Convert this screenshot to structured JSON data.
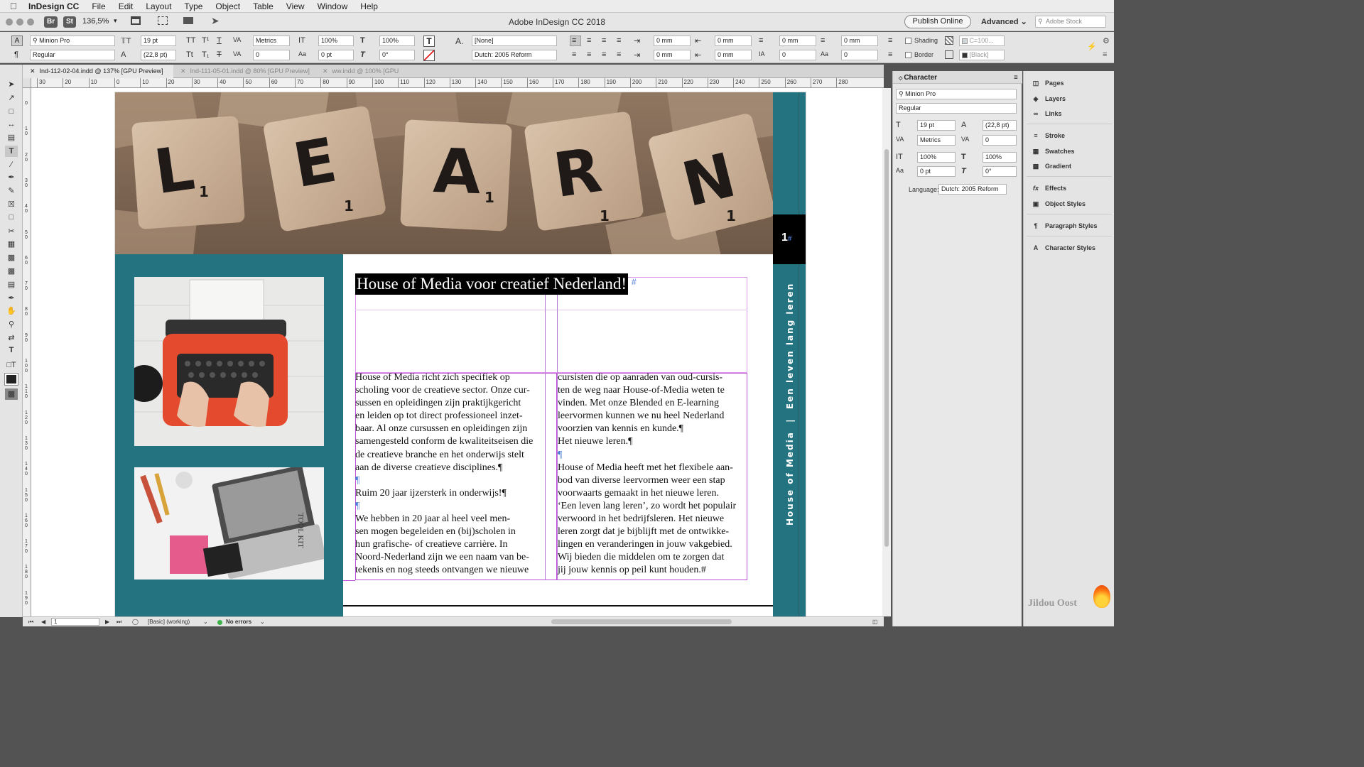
{
  "menubar": {
    "app": "InDesign CC",
    "items": [
      "File",
      "Edit",
      "Layout",
      "Type",
      "Object",
      "Table",
      "View",
      "Window",
      "Help"
    ]
  },
  "titlebar": {
    "title": "Adobe InDesign CC 2018",
    "bridge": "Br",
    "stock": "St",
    "zoom": "136,5%",
    "publish": "Publish Online",
    "workspace": "Advanced",
    "stock_search": "Adobe Stock"
  },
  "control": {
    "font": "Minion Pro",
    "style": "Regular",
    "size": "19 pt",
    "leading": "(22,8 pt)",
    "kerning": "Metrics",
    "tracking": "0",
    "vscale": "100%",
    "hscale": "100%",
    "baseline": "0 pt",
    "skew": "0°",
    "char_style": "[None]",
    "language": "Dutch: 2005 Reform",
    "indent_left": "0 mm",
    "indent_right": "0 mm",
    "first_indent": "0 mm",
    "last_indent": "0 mm",
    "space_before": "0 mm",
    "space_after": "0 mm",
    "drop_lines": "0",
    "drop_chars": "0",
    "shading": "Shading",
    "border": "Border",
    "shade_color": "C=100...",
    "border_color": "[Black]"
  },
  "tabs": [
    {
      "label": "Ind-112-02-04.indd @ 137% [GPU Preview]",
      "active": true
    },
    {
      "label": "Ind-111-05-01.indd @ 80% [GPU Preview]",
      "active": false
    },
    {
      "label": "ww.indd @ 100% [GPU Preview]",
      "active": false
    }
  ],
  "ruler": {
    "h": [
      "30",
      "20",
      "10",
      "0",
      "10",
      "20",
      "30",
      "40",
      "50",
      "60",
      "70",
      "80",
      "90",
      "100",
      "110",
      "120",
      "130",
      "140",
      "150",
      "160",
      "170",
      "180",
      "190",
      "200",
      "210",
      "220",
      "230",
      "240",
      "250",
      "260",
      "270",
      "280"
    ],
    "v": [
      "0",
      "1 0",
      "2 0",
      "3 0",
      "4 0",
      "5 0",
      "6 0",
      "7 0",
      "8 0",
      "9 0",
      "1 0 0",
      "1 1 0",
      "1 2 0",
      "1 3 0",
      "1 4 0",
      "1 5 0",
      "1 6 0",
      "1 7 0",
      "1 8 0",
      "1 9 0",
      "2 0 0"
    ]
  },
  "document": {
    "hero_tiles": [
      "L",
      "E",
      "A",
      "R",
      "N"
    ],
    "tile_score": "1",
    "page_number": "1",
    "page_number_mark": "#",
    "sidebar_text": "House of Media  |  Een leven lang leren",
    "tool_kit_label": "TOOL KIT",
    "heading": "House of Media voor creatief Nederland!",
    "heading_mark": "#",
    "col1": [
      "House of Media richt zich specifiek op",
      "scholing voor de creatieve sector. Onze cur-",
      "sussen en opleidingen zijn praktijkgericht",
      "en leiden op tot direct professioneel inzet-",
      "baar. Al onze cursussen en opleidingen zijn",
      "samengesteld conform de kwaliteitseisen die",
      "de creatieve branche en het onderwijs stelt",
      "aan de diverse creatieve disciplines.¶",
      "¶",
      "Ruim 20 jaar ijzersterk in onderwijs!¶",
      "¶",
      "We hebben in 20 jaar al heel veel men-",
      "sen mogen begeleiden en (bij)scholen in",
      "hun grafische- of creatieve carrière. In",
      "Noord-Nederland zijn we een naam van be-",
      "tekenis en nog steeds ontvangen we nieuwe"
    ],
    "col2": [
      "cursisten die op aanraden van oud-cursis-",
      "ten de weg naar House-of-Media weten te",
      "vinden. Met onze Blended en E-learning",
      "leervormen kunnen we nu heel Nederland",
      "voorzien van kennis en kunde.¶",
      "Het nieuwe leren.¶",
      "¶",
      "House of Media heeft met het flexibele aan-",
      "bod van diverse leervormen weer een stap",
      "voorwaarts gemaakt in het nieuwe leren.",
      "‘Een leven lang leren’, zo wordt het populair",
      "verwoord in het bedrijfsleren. Het nieuwe",
      "leren zorgt dat je bijblijft met de ontwikke-",
      "lingen en veranderingen in jouw vakgebied.",
      "Wij bieden die middelen om te zorgen dat",
      "jij jouw kennis op peil kunt houden.#"
    ]
  },
  "statusbar": {
    "page": "1",
    "preflight_profile": "[Basic] (working)",
    "errors": "No errors"
  },
  "character_panel": {
    "title": "Character",
    "font": "Minion Pro",
    "style": "Regular",
    "size": "19 pt",
    "leading": "(22,8 pt)",
    "kerning": "Metrics",
    "tracking": "0",
    "vscale": "100%",
    "hscale": "100%",
    "baseline": "0 pt",
    "skew": "0°",
    "language_label": "Language:",
    "language": "Dutch: 2005 Reform"
  },
  "dock": {
    "groups": [
      [
        "Pages",
        "Layers",
        "Links"
      ],
      [
        "Stroke",
        "Swatches",
        "Gradient"
      ],
      [
        "Effects",
        "Object Styles"
      ],
      [
        "Paragraph Styles"
      ],
      [
        "Character Styles"
      ]
    ],
    "icons": [
      "pages-icon",
      "layers-icon",
      "links-icon",
      "stroke-icon",
      "swatches-icon",
      "gradient-icon",
      "effects-icon",
      "object-styles-icon",
      "paragraph-styles-icon",
      "character-styles-icon"
    ]
  },
  "watermark": "Jildou Oost",
  "colors": {
    "teal": "#237480",
    "heading_bg": "#000000",
    "frame_guide": "#c04fd8",
    "ui_bg": "#e4e4e4"
  }
}
